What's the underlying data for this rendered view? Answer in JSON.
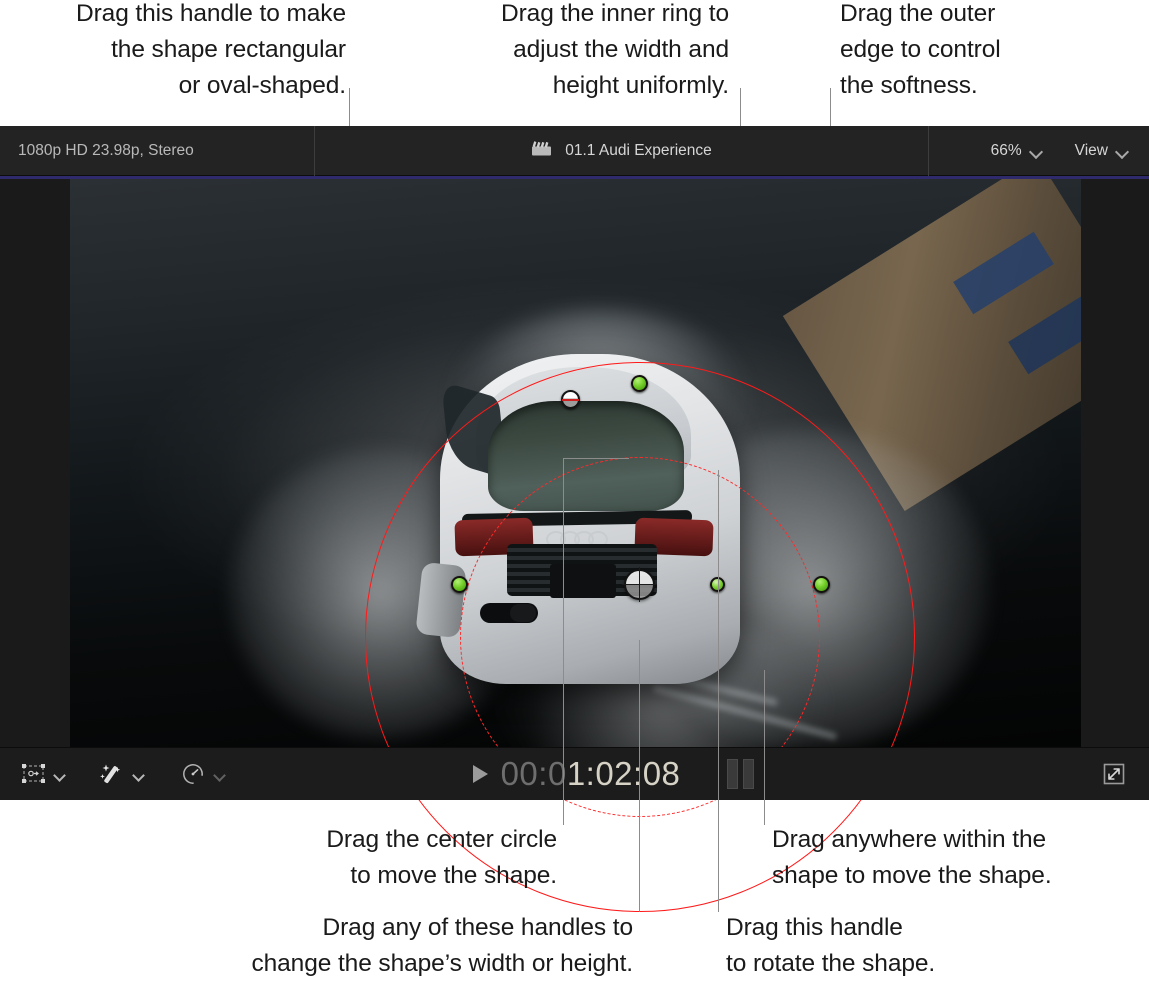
{
  "callouts": [
    {
      "id": "shape-handle",
      "text": "Drag this handle to make\nthe shape rectangular\nor oval-shaped."
    },
    {
      "id": "inner-ring",
      "text": "Drag the inner ring to\nadjust the width and\nheight uniformly."
    },
    {
      "id": "outer-edge",
      "text": "Drag the outer\nedge to control\nthe softness."
    },
    {
      "id": "center-circle",
      "text": "Drag the center circle\nto move the shape."
    },
    {
      "id": "move-shape",
      "text": "Drag anywhere within the\nshape to move the shape."
    },
    {
      "id": "size-handles",
      "text": "Drag any of these handles to\nchange the shape’s width or height."
    },
    {
      "id": "rotate-handle",
      "text": "Drag this handle\nto rotate the shape."
    }
  ],
  "viewer": {
    "titlebar": {
      "format": "1080p HD 23.98p, Stereo",
      "project_icon": "clapperboard-icon",
      "project_name": "01.1 Audi Experience",
      "zoom_level": "66%",
      "zoom_chevron": "chevron-down-icon",
      "view_label": "View",
      "view_chevron": "chevron-down-icon"
    },
    "toolbar": {
      "transform_icon": "transform-tool-icon",
      "transform_chevron": "chevron-down-icon",
      "enhance_icon": "magic-wand-icon",
      "enhance_chevron": "chevron-down-icon",
      "retime_icon": "speedometer-icon",
      "retime_chevron": "chevron-down-icon",
      "play_icon": "play-triangle-icon",
      "timecode_dim": "00:0",
      "timecode_bright": "1:02:08",
      "audio_meter": "audio-level-meter",
      "expand_icon": "fullscreen-expand-icon"
    },
    "mask": {
      "shape": "circle",
      "outer_ring_color": "#ff1a1a",
      "inner_ring_color": "#ff2a2a",
      "handle_color": "#76d12c",
      "handles": [
        "top-size-handle",
        "left-size-handle",
        "right-size-handle",
        "bottom-size-handle",
        "roundness-handle",
        "rotation-handle",
        "center-move-handle"
      ]
    },
    "accent_color": "#2f2a6b"
  }
}
